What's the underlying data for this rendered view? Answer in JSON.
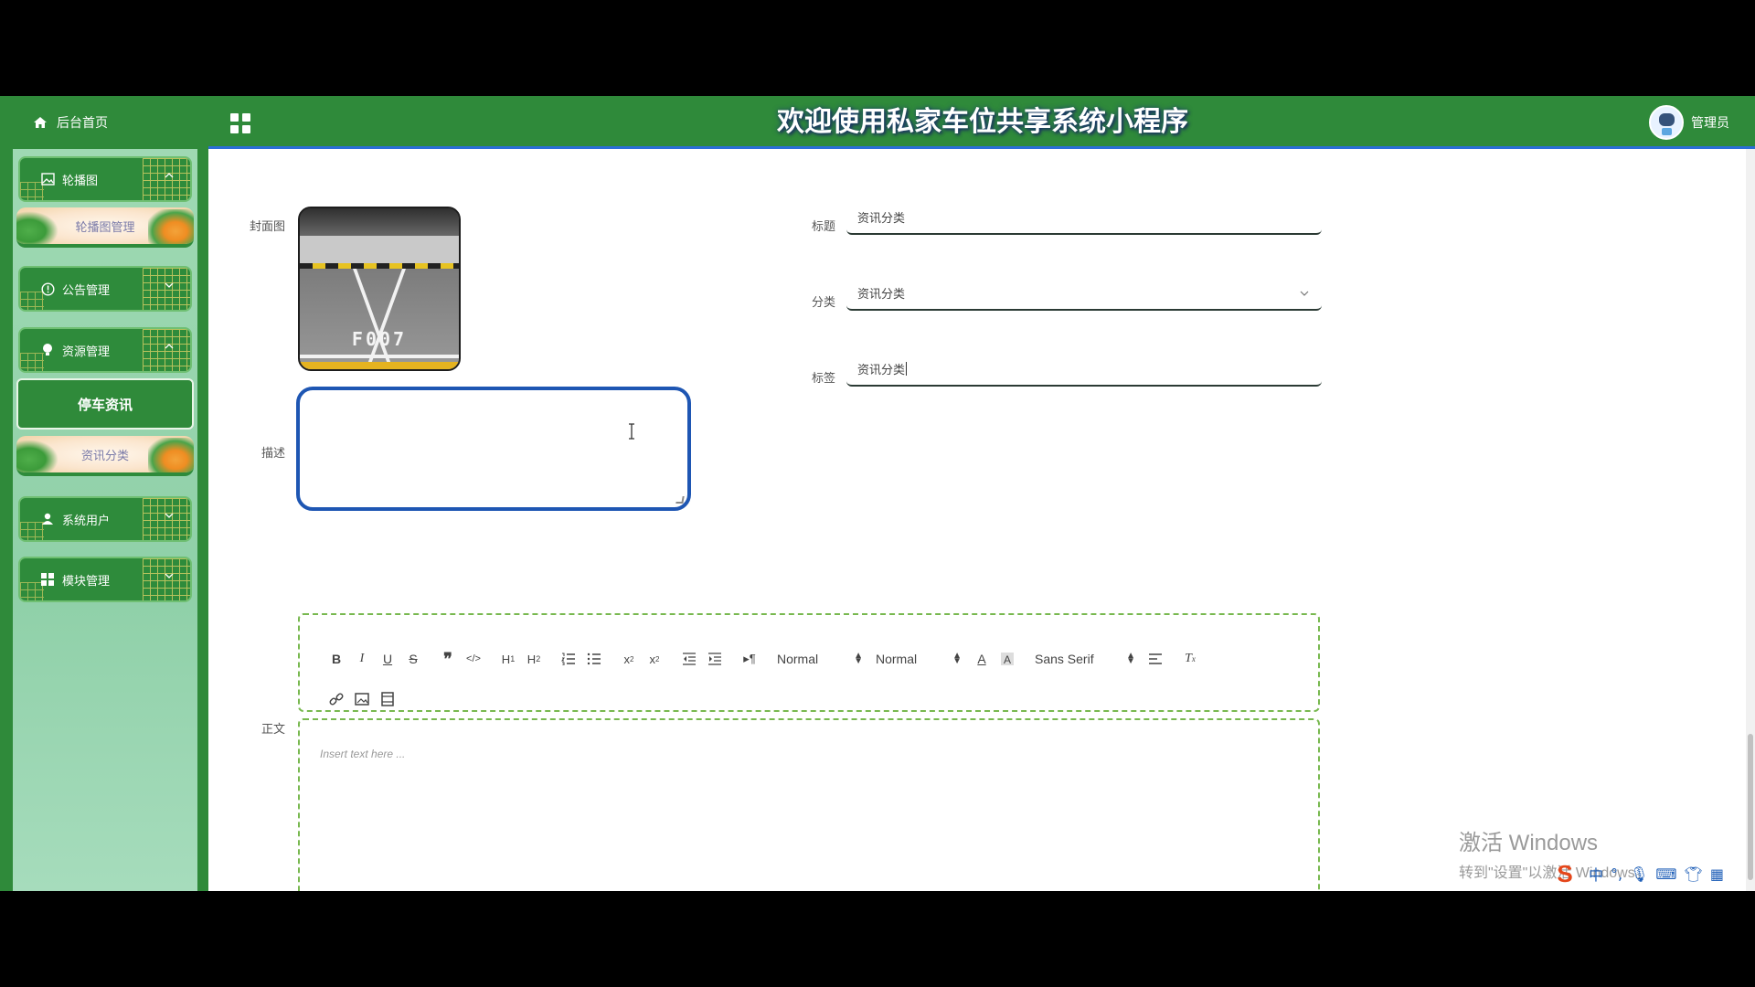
{
  "header": {
    "home_label": "后台首页",
    "title": "欢迎使用私家车位共享系统小程序",
    "user_label": "管理员"
  },
  "sidebar": {
    "menus": [
      {
        "label": "轮播图",
        "icon": "image-icon",
        "expanded": true
      },
      {
        "label": "公告管理",
        "icon": "info-circle-icon",
        "expanded": false
      },
      {
        "label": "资源管理",
        "icon": "bulb-icon",
        "expanded": true
      },
      {
        "label": "系统用户",
        "icon": "user-icon",
        "expanded": false
      },
      {
        "label": "模块管理",
        "icon": "grid-icon",
        "expanded": false
      }
    ],
    "submenus": [
      {
        "label": "轮播图管理"
      },
      {
        "label": "停车资讯",
        "active": true
      },
      {
        "label": "资讯分类"
      }
    ]
  },
  "form": {
    "cover_label": "封面图",
    "cover_image_text": "F007",
    "title_label": "标题",
    "title_value": "资讯分类",
    "category_label": "分类",
    "category_value": "资讯分类",
    "tag_label": "标签",
    "tag_value": "资讯分类",
    "desc_label": "描述",
    "desc_value": "",
    "content_label": "正文"
  },
  "editor": {
    "header_picker": "Normal",
    "size_picker": "Normal",
    "font_picker": "Sans Serif",
    "placeholder": "Insert text here ..."
  },
  "system": {
    "watermark_line1": "激活 Windows",
    "watermark_line2": "转到\"设置\"以激活 Windows。",
    "ime_label": "中"
  },
  "colors": {
    "primary_green": "#2f8a3a",
    "focus_blue": "#1e56b3",
    "sidebar_bg": "#9fd9b3"
  }
}
